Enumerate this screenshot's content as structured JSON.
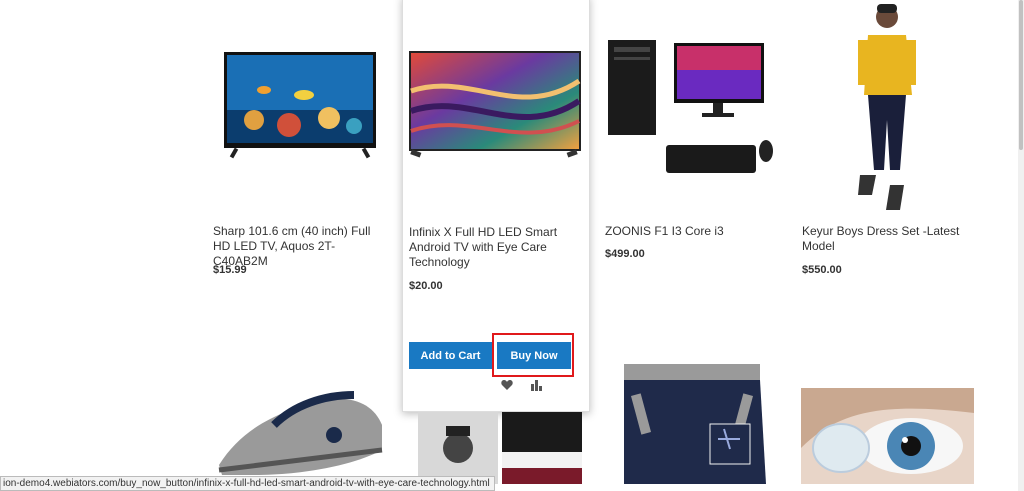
{
  "products": [
    {
      "name": "Sharp 101.6 cm (40 inch) Full HD LED TV, Aquos 2T-C40AB2M",
      "price": "$15.99"
    },
    {
      "name": "Infinix X Full HD LED Smart Android TV with Eye Care Technology",
      "price": "$20.00"
    },
    {
      "name": "ZOONIS F1 I3 Core i3",
      "price": "$499.00"
    },
    {
      "name": "Keyur Boys Dress Set -Latest Model",
      "price": "$550.00"
    }
  ],
  "hovered_card": {
    "add_to_cart_label": "Add to Cart",
    "buy_now_label": "Buy Now",
    "wishlist_icon": "heart-icon",
    "compare_icon": "compare-icon"
  },
  "status_bar": {
    "url": "ion-demo4.webiators.com/buy_now_button/infinix-x-full-hd-led-smart-android-tv-with-eye-care-technology.html"
  },
  "colors": {
    "primary_button": "#1979c3",
    "highlight": "#e0191b"
  }
}
